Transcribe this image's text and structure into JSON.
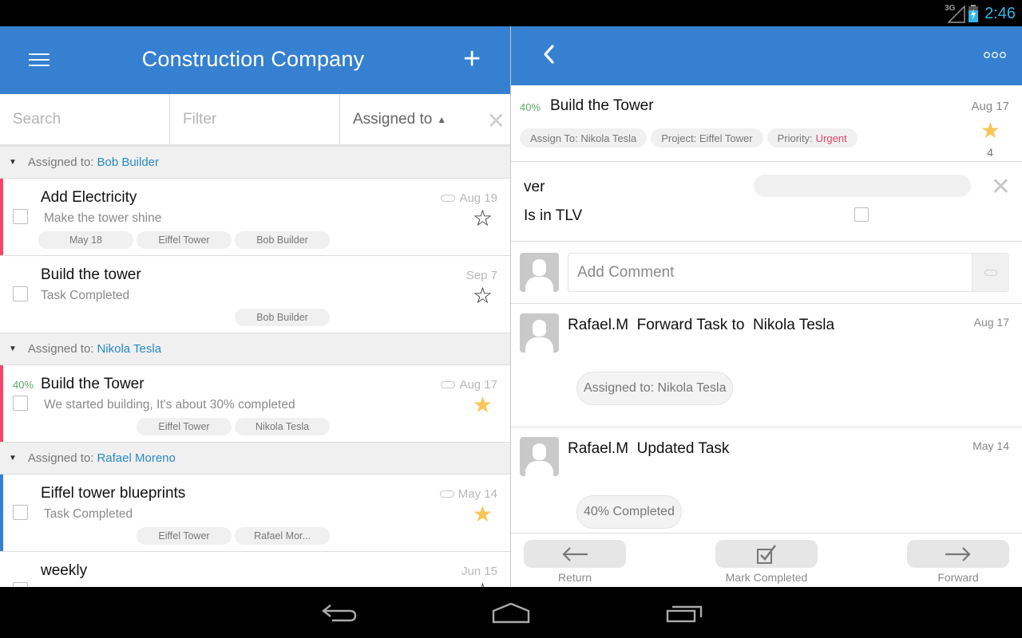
{
  "status_bar": {
    "network": "3G",
    "time": "2:46",
    "colors": {
      "clock": "#33b5e5"
    }
  },
  "list_panel": {
    "title": "Construction Company",
    "menu_icon": "hamburger-menu-icon",
    "add_icon": "plus-icon",
    "filters": {
      "search_placeholder": "Search",
      "filter_placeholder": "Filter",
      "sort_label": "Assigned to",
      "sort_direction": "ascending"
    },
    "groups": [
      {
        "label": "Assigned to:",
        "assignee": "Bob Builder",
        "tasks": [
          {
            "title": "Add Electricity",
            "subtitle": "Make the tower shine",
            "date": "Aug 19",
            "has_attachment": true,
            "starred": false,
            "priority_color": "#f5476a",
            "progress": "",
            "tags": [
              "May 18",
              "Eiffel Tower",
              "Bob Builder"
            ]
          },
          {
            "title": "Build the tower",
            "subtitle": "Task Completed",
            "date": "Sep 7",
            "has_attachment": false,
            "starred": false,
            "priority_color": "",
            "progress": "",
            "tags": [
              "",
              "",
              "Bob Builder"
            ]
          }
        ]
      },
      {
        "label": "Assigned to:",
        "assignee": "Nikola Tesla",
        "tasks": [
          {
            "title": "Build the Tower",
            "subtitle": "We started building, It's about 30% completed",
            "date": "Aug 17",
            "has_attachment": true,
            "starred": true,
            "priority_color": "#f5476a",
            "progress": "40%",
            "tags": [
              "",
              "Eiffel Tower",
              "Nikola Tesla"
            ]
          }
        ]
      },
      {
        "label": "Assigned to:",
        "assignee": "Rafael Moreno",
        "tasks": [
          {
            "title": "Eiffel tower blueprints",
            "subtitle": "Task Completed",
            "date": "May 14",
            "has_attachment": true,
            "starred": true,
            "priority_color": "#3580d0",
            "progress": "",
            "tags": [
              "",
              "Eiffel Tower",
              "Rafael Mor..."
            ]
          },
          {
            "title": "weekly",
            "subtitle": "",
            "date": "Jun 15",
            "has_attachment": false,
            "starred": false,
            "priority_color": "",
            "progress": "",
            "tags": []
          }
        ]
      }
    ]
  },
  "detail_panel": {
    "back_icon": "chevron-left-icon",
    "more_icon": "overflow-dots-icon",
    "task": {
      "progress": "40%",
      "title": "Build the Tower",
      "date": "Aug 17",
      "starred": true,
      "star_count": "4",
      "chips": {
        "assign": "Assign To: Nikola Tesla",
        "project": "Project: Eiffel Tower",
        "priority_label": "Priority:",
        "priority_value": "Urgent"
      }
    },
    "fields": {
      "field1_label": "ver",
      "field1_value": "",
      "field2_label": "Is in TLV",
      "field2_checked": false
    },
    "comment_placeholder": "Add Comment",
    "activity": [
      {
        "user": "Rafael.M",
        "action": "Forward Task to  Nikola Tesla",
        "date": "Aug 17",
        "bubble": "Assigned to:  Nikola Tesla"
      },
      {
        "user": "Rafael.M",
        "action": "Updated Task",
        "date": "May 14",
        "bubble": "40% Completed"
      }
    ],
    "actions": {
      "return_label": "Return",
      "complete_label": "Mark Completed",
      "forward_label": "Forward"
    }
  },
  "colors": {
    "app_bar": "#3580d0",
    "link": "#2a8ac2",
    "progress": "#5aa96a",
    "urgent": "#ea4266",
    "star": "#f9c558"
  }
}
